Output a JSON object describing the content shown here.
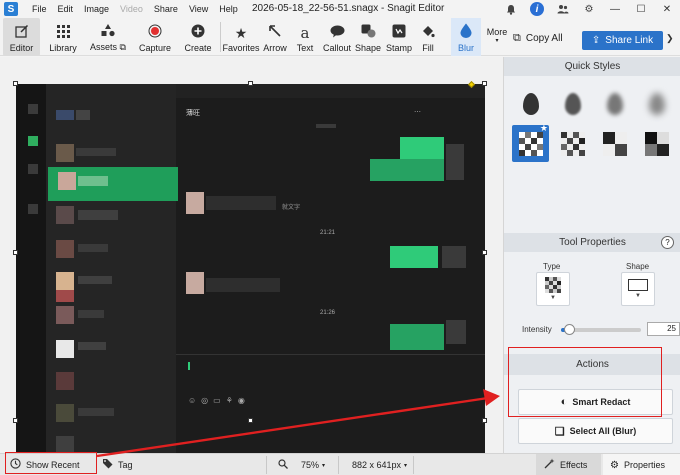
{
  "app": {
    "logo_letter": "S",
    "window_title": "2026-05-18_22-56-51.snagx - Snagit Editor"
  },
  "menu": [
    "File",
    "Edit",
    "Image",
    "Video",
    "Share",
    "View",
    "Help"
  ],
  "menu_disabled": [
    false,
    false,
    false,
    true,
    false,
    false,
    false
  ],
  "title_icons": {
    "bell": "bell-icon",
    "info": "i",
    "people": "people-icon",
    "gear": "gear-icon"
  },
  "window_controls": {
    "minimize": "—",
    "maximize": "☐",
    "close": "✕"
  },
  "toolbar": {
    "editor": "Editor",
    "library": "Library",
    "assets": "Assets",
    "capture": "Capture",
    "create": "Create",
    "tools": [
      "Favorites",
      "Arrow",
      "Text",
      "Callout",
      "Shape",
      "Stamp",
      "Fill",
      "Blur"
    ],
    "more": "More",
    "copy_all": "Copy All",
    "share_link": "Share Link"
  },
  "screenshot": {
    "window_name": "薄旺",
    "blurred_text_hint": "就文字",
    "times": [
      "21:21",
      "21:26"
    ]
  },
  "panel": {
    "quick_styles": "Quick Styles",
    "tool_properties": "Tool Properties",
    "help": "?",
    "type_label": "Type",
    "shape_label": "Shape",
    "intensity_label": "Intensity",
    "intensity_value": "25",
    "intensity_fraction": 0.1,
    "actions": "Actions",
    "smart_redact": "Smart Redact",
    "select_all_blur": "Select All (Blur)"
  },
  "statusbar": {
    "show_recent": "Show Recent",
    "tag": "Tag",
    "zoom": "75%",
    "dimensions": "882 x 641px",
    "effects": "Effects",
    "properties": "Properties"
  },
  "colors": {
    "accent": "#2b73c9",
    "annotation_red": "#e02020",
    "blur_green": "#2fcb79"
  }
}
